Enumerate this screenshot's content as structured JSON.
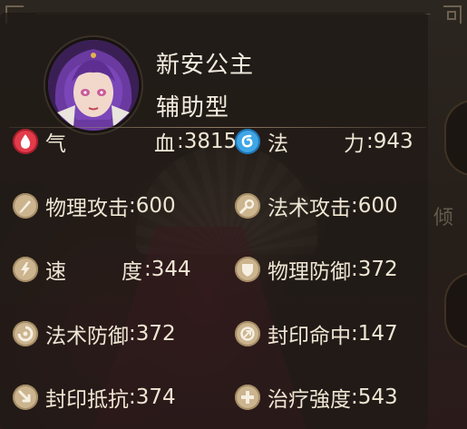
{
  "hero": {
    "name": "新安公主",
    "type": "辅助型"
  },
  "stats_left": [
    {
      "icon": "blood-drop-icon",
      "label_a": "气",
      "label_b": "血",
      "value": ":3815"
    },
    {
      "icon": "physical-attack-icon",
      "label": "物理攻击",
      "value": ":600"
    },
    {
      "icon": "speed-icon",
      "label_a": "速",
      "label_b": "度",
      "value": ":344"
    },
    {
      "icon": "magic-defense-icon",
      "label": "法术防御",
      "value": ":372"
    },
    {
      "icon": "seal-resist-icon",
      "label": "封印抵抗",
      "value": ":374"
    }
  ],
  "stats_right": [
    {
      "icon": "mana-swirl-icon",
      "label_a": "法",
      "label_b": "力",
      "value": ":943"
    },
    {
      "icon": "magic-attack-icon",
      "label": "法术攻击",
      "value": ":600"
    },
    {
      "icon": "physical-defense-icon",
      "label": "物理防御",
      "value": ":372"
    },
    {
      "icon": "seal-hit-icon",
      "label": "封印命中",
      "value": ":147"
    },
    {
      "icon": "healing-cross-icon",
      "label": "治疗強度",
      "value": ":543"
    }
  ],
  "background": {
    "side_text": "倾"
  },
  "colors": {
    "panel_bg": "#201a16",
    "icon_tan": "#cbb48e",
    "icon_red": "#e23b4a",
    "icon_blue": "#3fa6e6",
    "text": "#efe6d4"
  }
}
